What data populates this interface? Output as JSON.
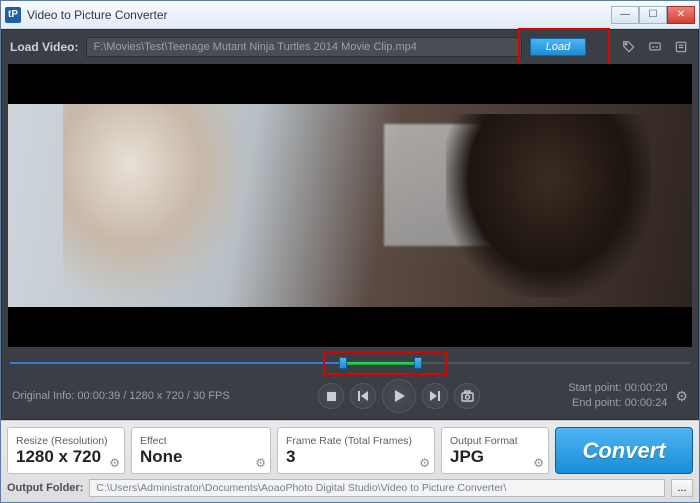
{
  "window": {
    "title": "Video to Picture Converter"
  },
  "loadbar": {
    "label": "Load Video:",
    "path": "F:\\Movies\\Test\\Teenage Mutant Ninja Turtles 2014 Movie Clip.mp4",
    "load_btn": "Load"
  },
  "icons": {
    "tag": "tag-icon",
    "subtitle": "subtitle-icon",
    "list": "list-icon"
  },
  "seek": {
    "progress_pct": 50,
    "range_start_pct": 49,
    "range_end_pct": 60
  },
  "info": {
    "original": "Original Info:  00:00:39 / 1280 x 720 / 30 FPS",
    "start_label": "Start point:",
    "start_val": "00:00:20",
    "end_label": "End point:",
    "end_val": "00:00:24"
  },
  "cards": {
    "resize": {
      "title": "Resize (Resolution)",
      "value": "1280 x 720"
    },
    "effect": {
      "title": "Effect",
      "value": "None"
    },
    "rate": {
      "title": "Frame Rate (Total Frames)",
      "value": "3"
    },
    "format": {
      "title": "Output Format",
      "value": "JPG"
    }
  },
  "convert_label": "Convert",
  "output": {
    "label": "Output Folder:",
    "path": "C:\\Users\\Administrator\\Documents\\AoaoPhoto Digital Studio\\Video to Picture Converter\\",
    "browse": "..."
  }
}
